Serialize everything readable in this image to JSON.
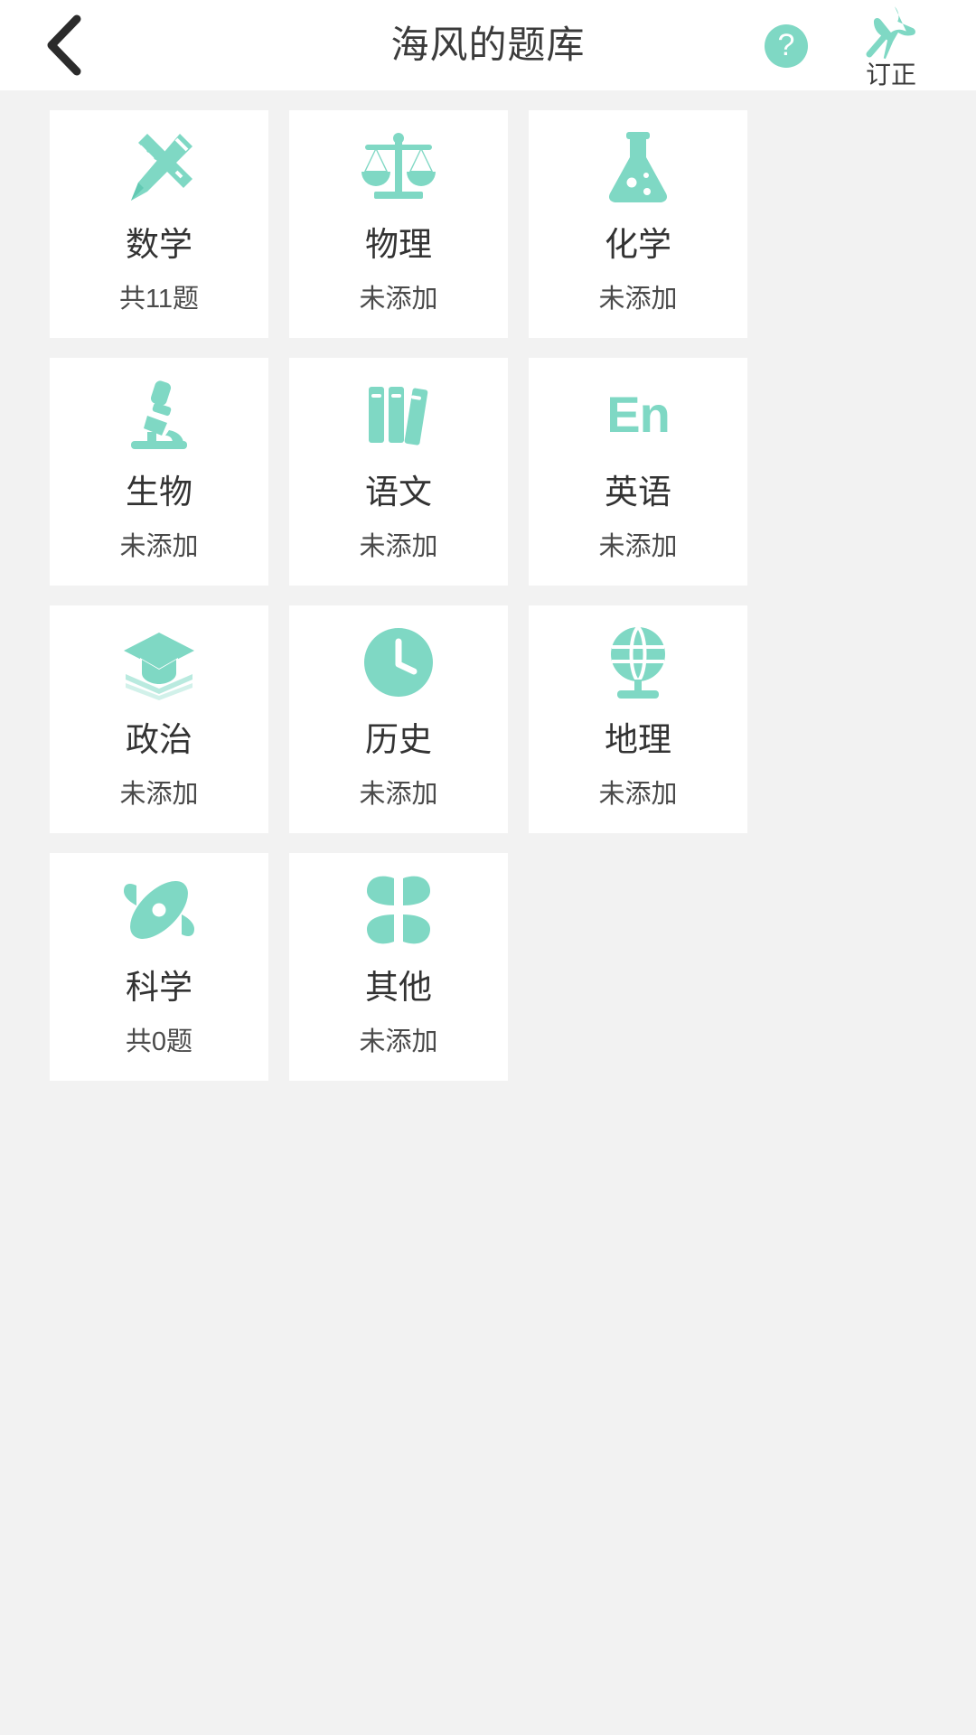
{
  "header": {
    "title": "海风的题库",
    "back_icon": "chevron-left-icon",
    "help_icon": "question-mark-icon",
    "help_glyph": "?",
    "pin_icon": "pushpin-icon",
    "pin_label": "订正"
  },
  "theme": {
    "accent": "#7fd8c4",
    "page_background": "#f2f2f2",
    "card_background": "#ffffff",
    "title_color": "#333333",
    "count_color": "#4a4a4a"
  },
  "grid": {
    "cards": [
      {
        "name": "数学",
        "count": "共11题",
        "icon": "pencil-ruler-icon"
      },
      {
        "name": "物理",
        "count": "未添加",
        "icon": "balance-scale-icon"
      },
      {
        "name": "化学",
        "count": "未添加",
        "icon": "flask-icon"
      },
      {
        "name": "生物",
        "count": "未添加",
        "icon": "microscope-icon"
      },
      {
        "name": "语文",
        "count": "未添加",
        "icon": "books-icon"
      },
      {
        "name": "英语",
        "count": "未添加",
        "icon": "en-text-icon"
      },
      {
        "name": "政治",
        "count": "未添加",
        "icon": "graduation-cap-icon"
      },
      {
        "name": "历史",
        "count": "未添加",
        "icon": "clock-icon"
      },
      {
        "name": "地理",
        "count": "未添加",
        "icon": "globe-icon"
      },
      {
        "name": "科学",
        "count": "共0题",
        "icon": "atom-icon"
      },
      {
        "name": "其他",
        "count": "未添加",
        "icon": "four-petals-icon"
      }
    ]
  }
}
